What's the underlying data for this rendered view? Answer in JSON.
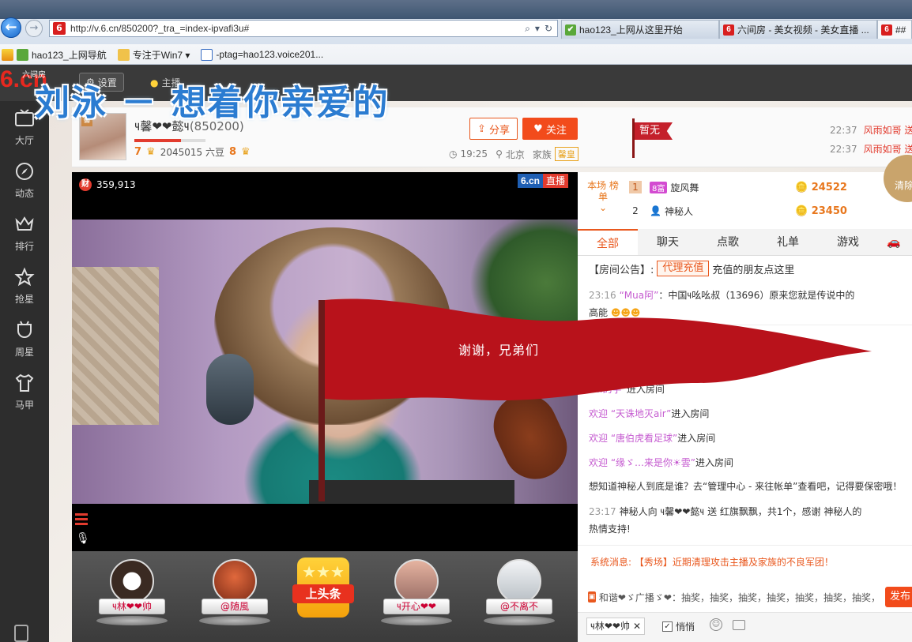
{
  "browser": {
    "url": "http://v.6.cn/850200?_tra_=index-ipvafi3u#",
    "tabs": [
      {
        "label": "hao123_上网从这里开始",
        "color": "#5aa83a",
        "icon": "✔"
      },
      {
        "label": "六间房 - 美女视频 - 美女直播 ...",
        "color": "#d81e1e",
        "icon": "6"
      },
      {
        "label": "##",
        "color": "#d81e1e",
        "icon": "6"
      }
    ],
    "bookmarks": [
      {
        "label": "hao123_上网导航"
      },
      {
        "label": "专注于Win7 ▾"
      },
      {
        "label": "-ptag=hao123.voice201..."
      }
    ]
  },
  "site": {
    "logo": "6.cn",
    "logo_sub": "六间房",
    "settings": "设置",
    "anchor_entry": "主播",
    "song_title": "刘泳 － 想着你亲爱的"
  },
  "sidenav": [
    {
      "label": "大厅",
      "icon": "tv-icon"
    },
    {
      "label": "动态",
      "icon": "compass-icon"
    },
    {
      "label": "排行",
      "icon": "crown-icon"
    },
    {
      "label": "抢星",
      "icon": "star-icon"
    },
    {
      "label": "周星",
      "icon": "cup-icon"
    },
    {
      "label": "马甲",
      "icon": "shirt-icon"
    }
  ],
  "anchor": {
    "name": "౺馨❤❤懿౺",
    "room_id": "(850200)",
    "level": "7",
    "beans": "2045015 六豆",
    "wealth_level": "8",
    "progress": 0.65,
    "share": "分享",
    "follow": "关注",
    "time": "19:25",
    "location": "北京",
    "family_label": "家族",
    "family": "馨皇",
    "banner": "暂无"
  },
  "ticker": [
    {
      "time": "22:37",
      "who": "风雨如哥 送"
    },
    {
      "time": "22:37",
      "who": "风雨如哥 送"
    }
  ],
  "video": {
    "viewers": "359,913",
    "brand": "6.cn",
    "live": "直播",
    "flag_text": "谢谢，兄弟们"
  },
  "guards": [
    {
      "label": "౺林❤❤帅",
      "color": "#3a2a22"
    },
    {
      "label": "@随風",
      "color": "#b4492d"
    },
    {
      "label": "౺开心❤❤",
      "color": "#c88a78"
    },
    {
      "label": "@不离不",
      "color": "#cfd4d8"
    }
  ],
  "headline": "上头条",
  "ranking": {
    "tab": "本场 榜单",
    "rows": [
      {
        "no": "1",
        "level": "8富",
        "name": "旋风舞",
        "score": "24522"
      },
      {
        "no": "2",
        "level": "",
        "name": "神秘人",
        "score": "23450"
      }
    ],
    "clear": "清除"
  },
  "chat": {
    "tabs": [
      "全部",
      "聊天",
      "点歌",
      "礼单",
      "游戏"
    ],
    "notice_label": "【房间公告】:",
    "notice_button": "代理充值",
    "notice_text": "充值的朋友点这里",
    "messages": [
      {
        "time": "23:16",
        "user": "“Mua阿”",
        "text": "：中国౺吆吆叔（13696）原来您就是传说中的"
      },
      {
        "time": "",
        "user": "",
        "text": "高能"
      },
      {
        "time": "",
        "user": "",
        "text": ""
      },
      {
        "time": "",
        "user": "",
        "text": ""
      },
      {
        "time": "",
        "user": "“...的字”",
        "text": "进入房间"
      },
      {
        "time": "",
        "user": "欢迎 “天诛地灭air”",
        "text": "进入房间"
      },
      {
        "time": "",
        "user": "欢迎 “唐伯虎看足球”",
        "text": "进入房间"
      },
      {
        "time": "",
        "user": "欢迎 “缘ゞ…来是你☀雲”",
        "text": "进入房间"
      },
      {
        "time": "",
        "user": "",
        "text": "想知道神秘人到底是谁？去“管理中心 - 来往帐单”查看吧，记得要保密哦！"
      },
      {
        "time": "23:17",
        "user": "",
        "text": "神秘人向 ౺馨❤❤懿౺ 送 红旗飘飘，共1个，感谢 神秘人的"
      },
      {
        "time": "",
        "user": "",
        "text": "热情支持!"
      }
    ],
    "system": "系统消息: 【秀场】近期清理攻击主播及家族的不良军团！",
    "broadcast": "和谐❤ゞ广播ゞ❤：抽奖，抽奖，抽奖，抽奖，抽奖，抽奖，抽奖，",
    "send": "发布",
    "target": "౺林❤❤帅",
    "whisper": "悄悄"
  }
}
